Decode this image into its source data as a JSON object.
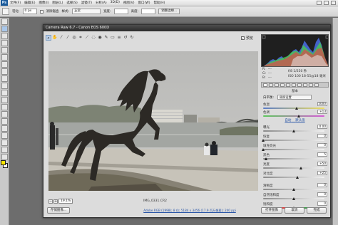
{
  "photoshop": {
    "logo": "Ps",
    "menu": [
      "文件(F)",
      "编辑(E)",
      "图像(I)",
      "图层(L)",
      "选择(S)",
      "滤镜(T)",
      "分析(A)",
      "3D(D)",
      "视图(V)",
      "窗口(W)",
      "帮助(H)"
    ],
    "options": {
      "feather_label": "羽化:",
      "feather_value": "0 px",
      "antialias_label": "消除锯齿",
      "style_label": "样式:",
      "style_value": "正常",
      "width_label": "宽度:",
      "height_label": "高度:",
      "refine_edge_button": "调整边缘..."
    }
  },
  "camera_raw": {
    "title": "Camera Raw 6.7 -  Canon EOS 600D",
    "preview_label": "预览",
    "zoom_value": "19.1%",
    "filename": "IMG_0331.CR2",
    "info": {
      "r_label": "R:",
      "g_label": "G:",
      "b_label": "B:",
      "r_value": "---",
      "g_value": "---",
      "b_value": "---",
      "exposure": "f/8  1/250 秒",
      "iso": "ISO 100  18-55@18 毫米"
    },
    "basic_title": "基本",
    "white_balance_label": "白平衡:",
    "white_balance_value": "原照设置",
    "sliders_a": [
      {
        "label": "色温",
        "value": "5000",
        "pos": 0.55,
        "kind": "temp"
      },
      {
        "label": "色调",
        "value": "+13",
        "pos": 0.58,
        "kind": "tint"
      }
    ],
    "auto_label": "自动",
    "default_label": "默认值",
    "sliders_b": [
      {
        "label": "曝光",
        "value": "0.00",
        "pos": 0.5,
        "kind": "plain"
      },
      {
        "label": "恢复",
        "value": "0",
        "pos": 0.0,
        "kind": "plain"
      },
      {
        "label": "填充亮光",
        "value": "0",
        "pos": 0.0,
        "kind": "plain"
      },
      {
        "label": "黑色",
        "value": "5",
        "pos": 0.05,
        "kind": "plain"
      },
      {
        "label": "亮度",
        "value": "+50",
        "pos": 0.62,
        "kind": "plain"
      },
      {
        "label": "对比度",
        "value": "+25",
        "pos": 0.56,
        "kind": "plain"
      }
    ],
    "sliders_c": [
      {
        "label": "清晰度",
        "value": "0",
        "pos": 0.5,
        "kind": "plain"
      },
      {
        "label": "自然饱和度",
        "value": "0",
        "pos": 0.5,
        "kind": "plain"
      },
      {
        "label": "饱和度",
        "value": "0",
        "pos": 0.5,
        "kind": "sat"
      }
    ],
    "buttons": {
      "save": "存储图像...",
      "open": "打开图像",
      "cancel": "取消",
      "done": "完成"
    },
    "workflow_link": "Adobe RGB (1998); 8 位; 5184 x 3456 (17.9 百万像素); 240 ppi"
  }
}
